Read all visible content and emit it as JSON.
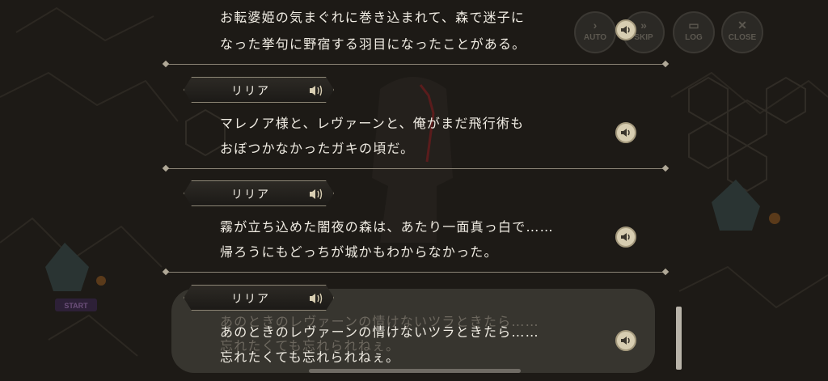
{
  "controls": {
    "auto": "AUTO",
    "skip": "SKIP",
    "log": "LOG",
    "close": "CLOSE"
  },
  "map": {
    "start_label": "START"
  },
  "backlog": [
    {
      "speaker": "",
      "line1": "お転婆姫の気まぐれに巻き込まれて、森で迷子に",
      "line2": "なった挙句に野宿する羽目になったことがある。"
    },
    {
      "speaker": "リリア",
      "line1": "マレノア様と、レヴァーンと、俺がまだ飛行術も",
      "line2": "おぼつかなかったガキの頃だ。"
    },
    {
      "speaker": "リリア",
      "line1": "霧が立ち込めた闇夜の森は、あたり一面真っ白で……",
      "line2": "帰ろうにもどっちが城かもわからなかった。"
    },
    {
      "speaker": "リリア",
      "line1": "あのときのレヴァーンの情けないツラときたら……",
      "line2": "忘れたくても忘れられねぇ。"
    }
  ],
  "message_window": {
    "ghost_line1": "あのときのレヴァーンの情けないツラときたら……",
    "ghost_line2": "忘れたくても忘れられねぇ。"
  },
  "colors": {
    "text": "#f1ede4",
    "accent_gold": "#d7cdb1",
    "overlay": "#1b1814"
  }
}
